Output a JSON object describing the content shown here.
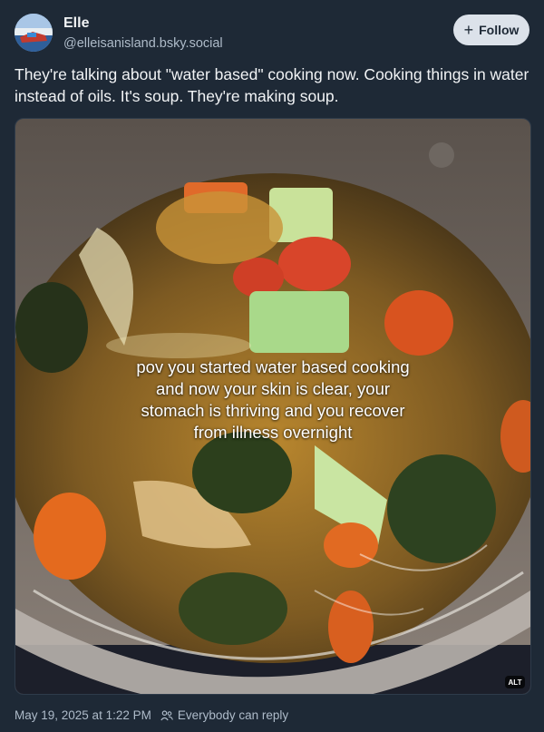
{
  "author": {
    "display_name": "Elle",
    "handle": "@elleisanisland.bsky.social"
  },
  "follow_button": {
    "label": "Follow",
    "icon": "plus-icon"
  },
  "post": {
    "text": "They're talking about \"water based\" cooking now. Cooking things in water instead of oils. It's soup. They're making soup.",
    "image": {
      "overlay_lines": [
        "pov you started water based cooking",
        "and now your skin is clear, your",
        "stomach is thriving and you recover",
        "from illness overnight"
      ],
      "alt_badge": "ALT"
    }
  },
  "footer": {
    "timestamp": "May 19, 2025 at 1:22 PM",
    "reply_setting": "Everybody can reply",
    "reply_icon": "people-icon"
  },
  "colors": {
    "background": "#1e2936",
    "text": "#f1f3f5",
    "muted": "#aebbc9",
    "follow_bg": "#dce2ea"
  }
}
